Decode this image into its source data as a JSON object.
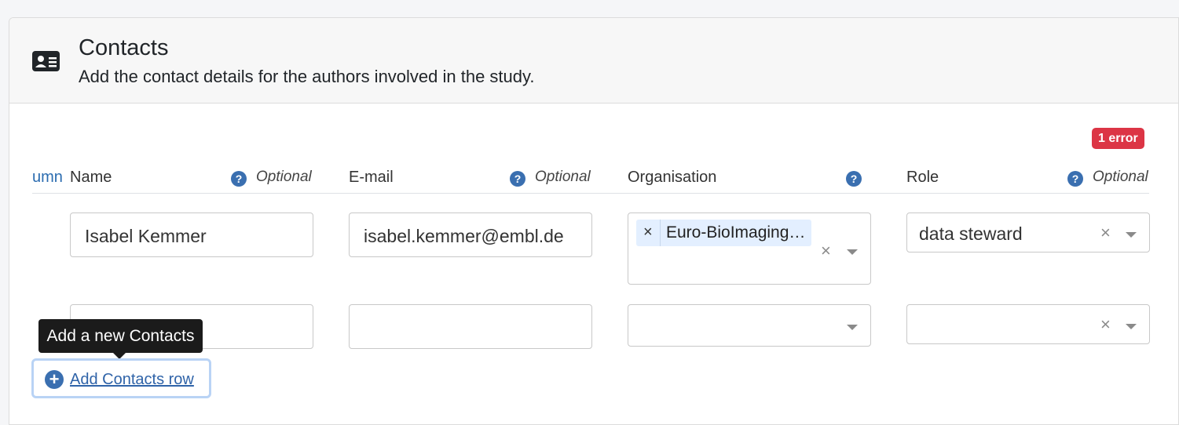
{
  "section": {
    "title": "Contacts",
    "subtitle": "Add the contact details for the authors involved in the study.",
    "icon": "contact-card-icon"
  },
  "error_badge": "1 error",
  "truncated_header": "umn",
  "columns": [
    {
      "label": "Name",
      "help": "?",
      "optional": "Optional"
    },
    {
      "label": "E-mail",
      "help": "?",
      "optional": "Optional"
    },
    {
      "label": "Organisation",
      "help": "?",
      "optional": ""
    },
    {
      "label": "Role",
      "help": "?",
      "optional": "Optional"
    }
  ],
  "rows": [
    {
      "name": "Isabel Kemmer",
      "email": "isabel.kemmer@embl.de",
      "organisation_tag": "Euro-BioImaging…",
      "role": "data steward"
    },
    {
      "name": "",
      "email": "",
      "organisation_tag": "",
      "role": ""
    }
  ],
  "tooltip": "Add a new Contacts",
  "add_row": {
    "label": " Add Contacts row",
    "icon": "plus-circle-icon"
  },
  "glyphs": {
    "clear": "×",
    "tag_remove": "×",
    "plus": "+"
  },
  "colors": {
    "accent": "#3a6fb0",
    "error": "#dc3545",
    "tag_bg": "#e3efff"
  }
}
